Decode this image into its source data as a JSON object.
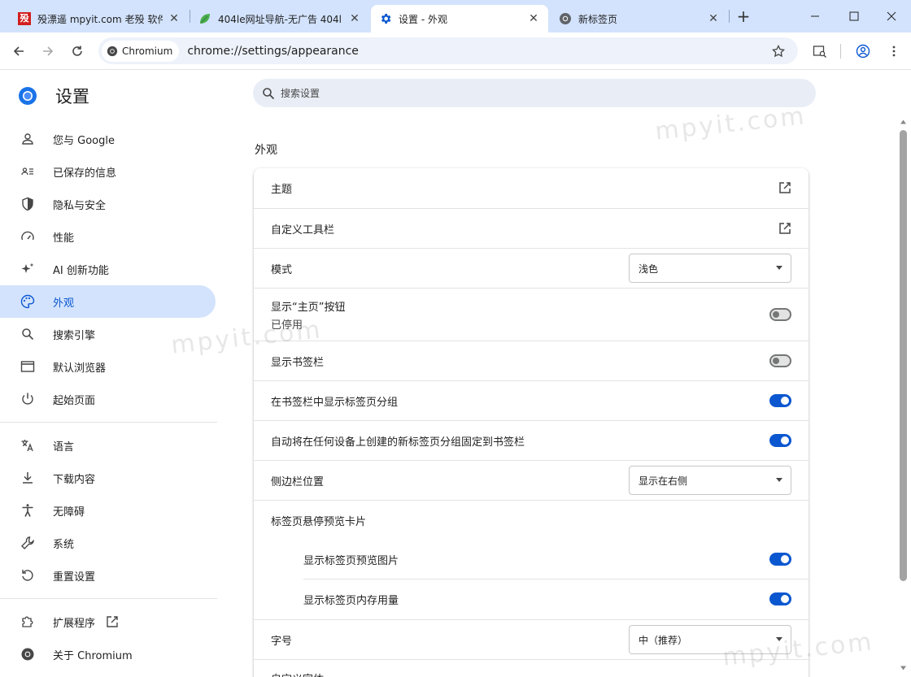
{
  "tabs": [
    {
      "title": "殁漂遥 mpyit.com 老殁 软件",
      "favicon": "mpyit-logo-icon",
      "active": false
    },
    {
      "title": "404le网址导航-无广告 404l",
      "favicon": "leaf-icon",
      "active": false
    },
    {
      "title": "设置 - 外观",
      "favicon": "gear-icon",
      "active": true
    },
    {
      "title": "新标签页",
      "favicon": "chromium-icon",
      "active": false
    }
  ],
  "tab_favicon_text": "殁",
  "omnibox": {
    "chip_label": "Chromium",
    "url": "chrome://settings/appearance"
  },
  "sidebar": {
    "brand": "设置",
    "items": [
      {
        "label": "您与 Google",
        "icon": "person-icon"
      },
      {
        "label": "已保存的信息",
        "icon": "badge-icon"
      },
      {
        "label": "隐私与安全",
        "icon": "shield-icon"
      },
      {
        "label": "性能",
        "icon": "speedometer-icon"
      },
      {
        "label": "AI 创新功能",
        "icon": "sparkle-icon"
      },
      {
        "label": "外观",
        "icon": "palette-icon",
        "active": true
      },
      {
        "label": "搜索引擎",
        "icon": "search-icon"
      },
      {
        "label": "默认浏览器",
        "icon": "browser-window-icon"
      },
      {
        "label": "起始页面",
        "icon": "power-icon"
      },
      {
        "label": "语言",
        "icon": "translate-icon"
      },
      {
        "label": "下载内容",
        "icon": "download-icon"
      },
      {
        "label": "无障碍",
        "icon": "accessibility-icon"
      },
      {
        "label": "系统",
        "icon": "wrench-icon"
      },
      {
        "label": "重置设置",
        "icon": "reset-icon"
      },
      {
        "label": "扩展程序",
        "icon": "puzzle-icon"
      },
      {
        "label": "关于 Chromium",
        "icon": "chromium-icon"
      }
    ]
  },
  "search": {
    "placeholder": "搜索设置"
  },
  "section_title": "外观",
  "settings": {
    "theme": "主题",
    "customize_toolbar": "自定义工具栏",
    "mode_label": "模式",
    "mode_value": "浅色",
    "home_button_label": "显示“主页”按钮",
    "home_button_sub": "已停用",
    "home_button_on": false,
    "bookmarks_bar_label": "显示书签栏",
    "bookmarks_bar_on": false,
    "tab_groups_label": "在书签栏中显示标签页分组",
    "tab_groups_on": true,
    "pin_tab_groups_label": "自动将在任何设备上创建的新标签页分组固定到书签栏",
    "pin_tab_groups_on": true,
    "side_panel_label": "侧边栏位置",
    "side_panel_value": "显示在右侧",
    "hover_card_label": "标签页悬停预览卡片",
    "hover_preview_label": "显示标签页预览图片",
    "hover_preview_on": true,
    "hover_memory_label": "显示标签页内存用量",
    "hover_memory_on": true,
    "font_size_label": "字号",
    "font_size_value": "中（推荐）",
    "customize_fonts_partial": "自定义字体"
  },
  "watermark": "mpyit.com",
  "colors": {
    "accent": "#0b57d0",
    "tabstrip": "#d3e3fd"
  }
}
